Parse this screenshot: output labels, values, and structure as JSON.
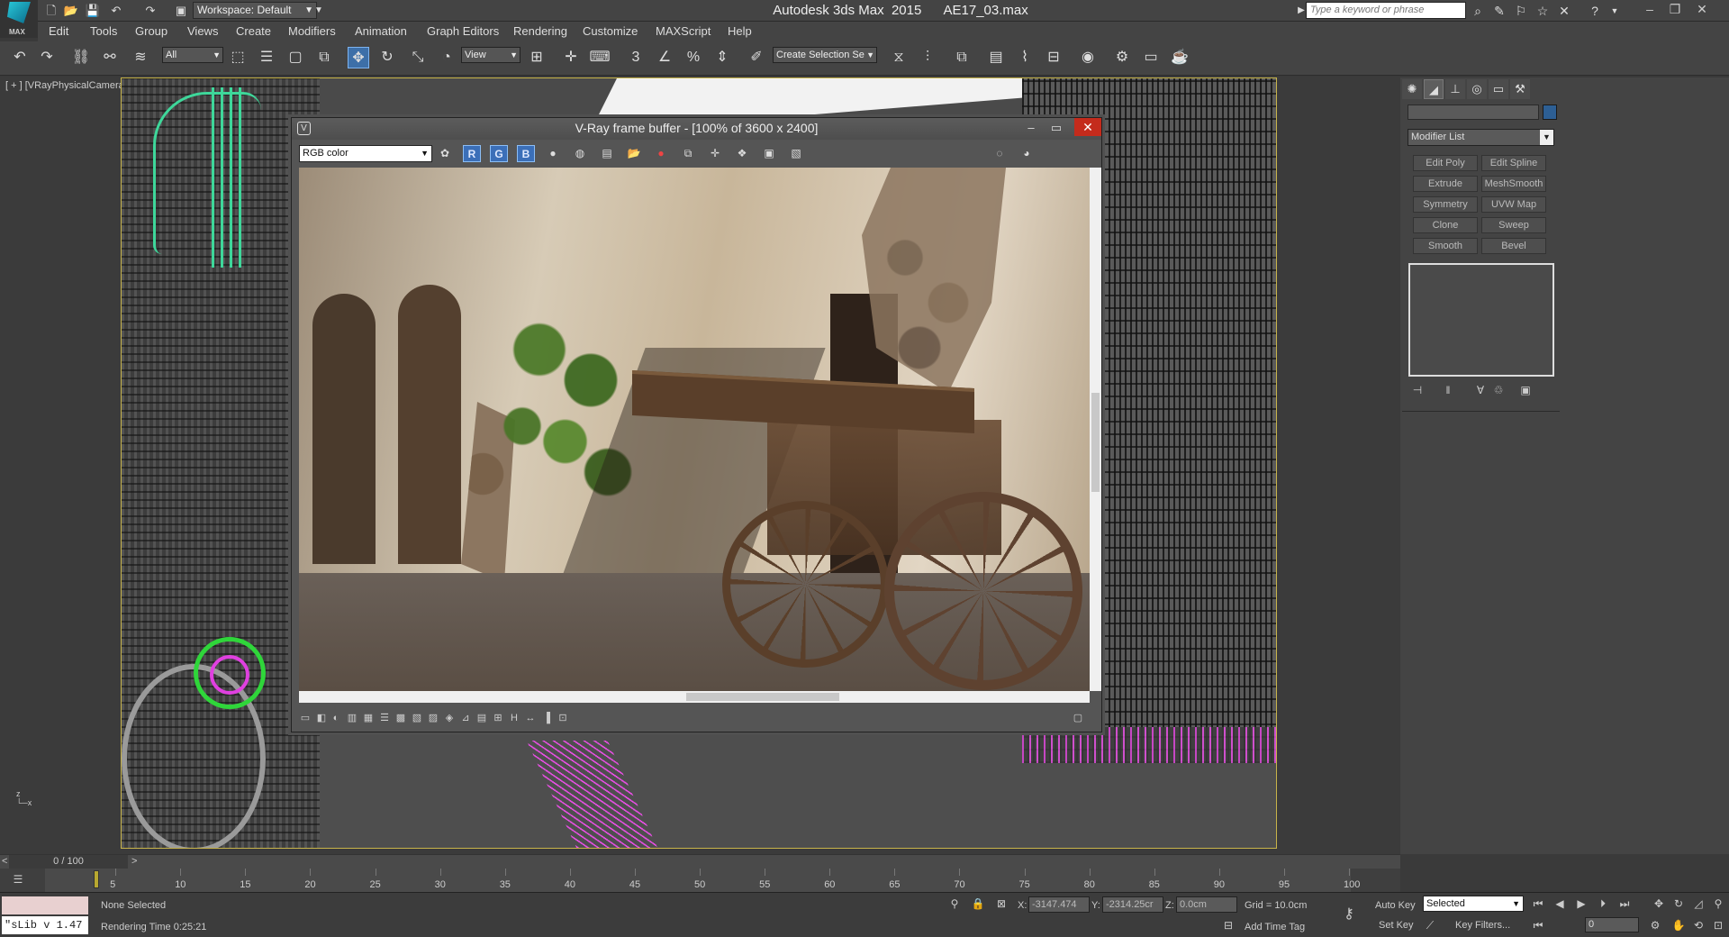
{
  "app": {
    "title": "Autodesk 3ds Max  2015      AE17_03.max",
    "logo_text": "MAX",
    "workspace": "Workspace: Default",
    "search_placeholder": "Type a keyword or phrase"
  },
  "menus": [
    "Edit",
    "Tools",
    "Group",
    "Views",
    "Create",
    "Modifiers",
    "Animation",
    "Graph Editors",
    "Rendering",
    "Customize",
    "MAXScript",
    "Help"
  ],
  "toolbar": {
    "selection_filter": "All",
    "reference_coord": "View",
    "named_selection": "Create Selection Se",
    "snap_labels": [
      "3",
      "",
      "%",
      ""
    ]
  },
  "viewport": {
    "label": "[ + ] [VRayPhysicalCamera"
  },
  "vfb": {
    "title": "V-Ray frame buffer - [100% of 3600 x 2400]",
    "channel": "RGB color",
    "rgb_buttons": [
      "R",
      "G",
      "B"
    ]
  },
  "command_panel": {
    "modifier_list": "Modifier List",
    "modifier_buttons": [
      "Edit Poly",
      "Edit Spline",
      "Extrude",
      "MeshSmooth",
      "Symmetry",
      "UVW Map",
      "Clone",
      "Sweep",
      "Smooth",
      "Bevel"
    ]
  },
  "timeline": {
    "frame_display": "0 / 100",
    "ticks": [
      "5",
      "10",
      "15",
      "20",
      "25",
      "30",
      "35",
      "40",
      "45",
      "50",
      "55",
      "60",
      "65",
      "70",
      "75",
      "80",
      "85",
      "90",
      "95",
      "100"
    ]
  },
  "status": {
    "listener_text": "\"sLib v 1.47",
    "selection": "None Selected",
    "render_time": "Rendering Time  0:25:21",
    "x_label": "X:",
    "x_value": "-3147.474",
    "y_label": "Y:",
    "y_value": "-2314.25cr",
    "z_label": "Z:",
    "z_value": "0.0cm",
    "grid": "Grid = 10.0cm",
    "add_time_tag": "Add Time Tag",
    "auto_key": "Auto Key",
    "selected_option": "Selected",
    "set_key": "Set Key",
    "key_filters": "Key Filters...",
    "current_frame": "0"
  }
}
